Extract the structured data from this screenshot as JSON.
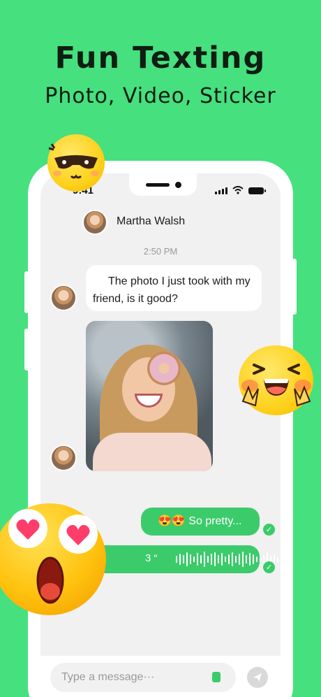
{
  "header": {
    "title": "Fun Texting",
    "subtitle": "Photo, Video, Sticker"
  },
  "status_bar": {
    "time": "9:41"
  },
  "chat": {
    "contact_name": "Martha Walsh",
    "timestamp": "2:50 PM",
    "messages": [
      {
        "direction": "in",
        "type": "text",
        "text": "The photo I just took with my friend, is it good?"
      },
      {
        "direction": "in",
        "type": "image"
      },
      {
        "direction": "out",
        "type": "text",
        "text": "😍😍 So pretty...",
        "read": true
      },
      {
        "direction": "out",
        "type": "voice",
        "duration": "3 “",
        "read": true
      }
    ]
  },
  "composer": {
    "placeholder": "Type a message···"
  },
  "colors": {
    "background": "#46e07f",
    "bubble_out": "#3bcb6b",
    "emoji_yellow": "#fed11c"
  }
}
